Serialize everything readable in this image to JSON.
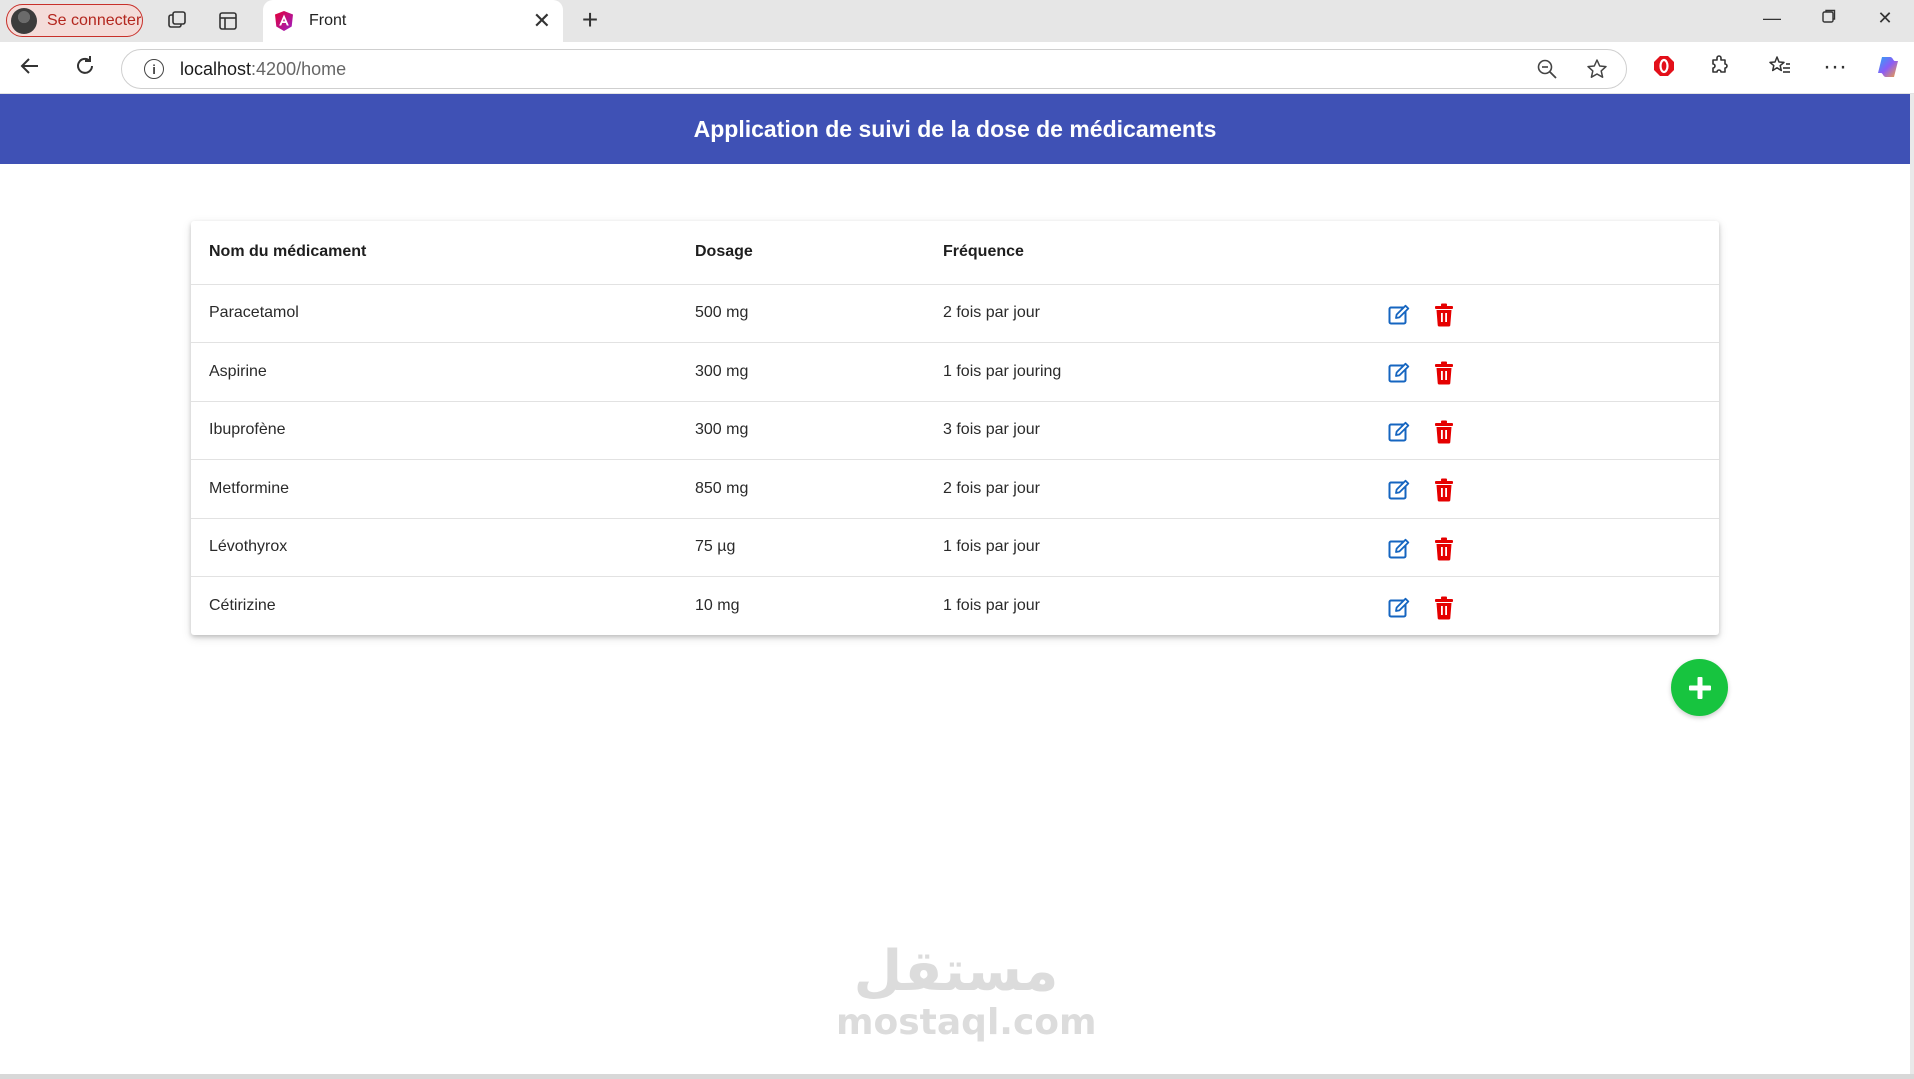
{
  "browser": {
    "profile_label": "Se connecter",
    "tab_title": "Front",
    "url_host": "localhost",
    "url_path": ":4200/home"
  },
  "app": {
    "title": "Application de suivi de la dose de médicaments",
    "header_color": "#3f51b5",
    "fab_color": "#17c43f",
    "edit_color": "#1565c0",
    "delete_color": "#e50000"
  },
  "table": {
    "headers": [
      "Nom du médicament",
      "Dosage",
      "Fréquence"
    ],
    "rows": [
      {
        "name": "Paracetamol",
        "dosage": "500 mg",
        "frequency": "2 fois par jour"
      },
      {
        "name": "Aspirine",
        "dosage": "300 mg",
        "frequency": "1 fois par jouring"
      },
      {
        "name": "Ibuprofène",
        "dosage": "300 mg",
        "frequency": "3 fois par jour"
      },
      {
        "name": "Metformine",
        "dosage": "850 mg",
        "frequency": "2 fois par jour"
      },
      {
        "name": "Lévothyrox",
        "dosage": "75 µg",
        "frequency": "1 fois par jour"
      },
      {
        "name": "Cétirizine",
        "dosage": "10 mg",
        "frequency": "1 fois par jour"
      }
    ]
  },
  "watermark": {
    "arabic": "مستقل",
    "latin": "mostaql.com"
  }
}
